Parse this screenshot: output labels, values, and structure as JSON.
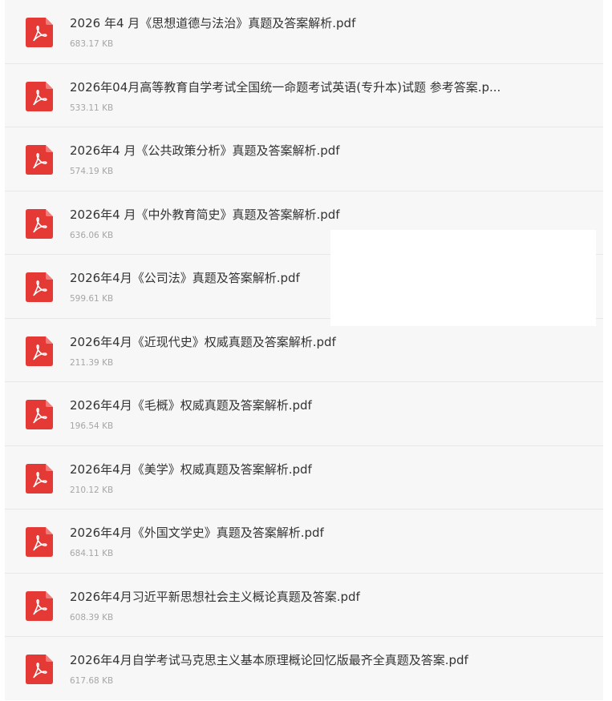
{
  "colors": {
    "list_background": "#f7f7f7",
    "pdf_icon": "#e53935",
    "file_name_text": "#333333",
    "file_size_text": "#a6a6a6"
  },
  "files": [
    {
      "icon": "pdf-icon",
      "name": "2026 年4 月《思想道德与法治》真题及答案解析.pdf",
      "size": "683.17 KB"
    },
    {
      "icon": "pdf-icon",
      "name": "2026年04月高等教育自学考试全国统一命题考试英语(专升本)试题 参考答案.p...",
      "size": "533.11 KB"
    },
    {
      "icon": "pdf-icon",
      "name": "2026年4 月《公共政策分析》真题及答案解析.pdf",
      "size": "574.19 KB"
    },
    {
      "icon": "pdf-icon",
      "name": "2026年4 月《中外教育简史》真题及答案解析.pdf",
      "size": "636.06 KB"
    },
    {
      "icon": "pdf-icon",
      "name": "2026年4月《公司法》真题及答案解析.pdf",
      "size": "599.61 KB"
    },
    {
      "icon": "pdf-icon",
      "name": "2026年4月《近现代史》权威真题及答案解析.pdf",
      "size": "211.39 KB"
    },
    {
      "icon": "pdf-icon",
      "name": "2026年4月《毛概》权威真题及答案解析.pdf",
      "size": "196.54 KB"
    },
    {
      "icon": "pdf-icon",
      "name": "2026年4月《美学》权威真题及答案解析.pdf",
      "size": "210.12 KB"
    },
    {
      "icon": "pdf-icon",
      "name": "2026年4月《外国文学史》真题及答案解析.pdf",
      "size": "684.11 KB"
    },
    {
      "icon": "pdf-icon",
      "name": "2026年4月习近平新思想社会主义概论真题及答案.pdf",
      "size": "608.39 KB"
    },
    {
      "icon": "pdf-icon",
      "name": "2026年4月自学考试马克思主义基本原理概论回忆版最齐全真题及答案.pdf",
      "size": "617.68 KB"
    }
  ]
}
